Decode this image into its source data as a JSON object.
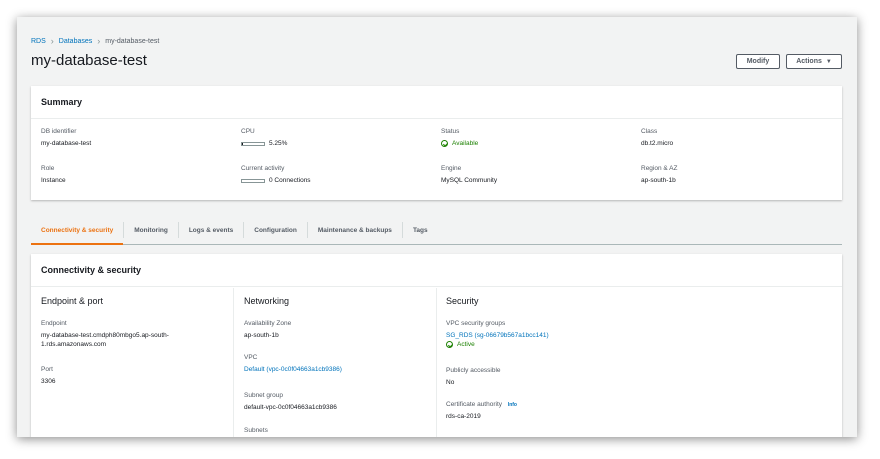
{
  "breadcrumb": {
    "items": [
      "RDS",
      "Databases",
      "my-database-test"
    ]
  },
  "page_title": "my-database-test",
  "buttons": {
    "modify": "Modify",
    "actions": "Actions"
  },
  "summary": {
    "title": "Summary",
    "db_identifier_label": "DB identifier",
    "db_identifier": "my-database-test",
    "role_label": "Role",
    "role": "Instance",
    "cpu_label": "CPU",
    "cpu": "5.25%",
    "cpu_fraction": 0.0525,
    "activity_label": "Current activity",
    "activity": "0 Connections",
    "activity_fraction": 0,
    "status_label": "Status",
    "status": "Available",
    "engine_label": "Engine",
    "engine": "MySQL Community",
    "class_label": "Class",
    "class": "db.t2.micro",
    "region_label": "Region & AZ",
    "region": "ap-south-1b"
  },
  "tabs": [
    "Connectivity & security",
    "Monitoring",
    "Logs & events",
    "Configuration",
    "Maintenance & backups",
    "Tags"
  ],
  "connectivity": {
    "title": "Connectivity & security",
    "endpoint_port": {
      "title": "Endpoint & port",
      "endpoint_label": "Endpoint",
      "endpoint_line1": "my-database-test.cmdph80mbgo5.ap-south-",
      "endpoint_line2": "1.rds.amazonaws.com",
      "port_label": "Port",
      "port": "3306"
    },
    "networking": {
      "title": "Networking",
      "az_label": "Availability Zone",
      "az": "ap-south-1b",
      "vpc_label": "VPC",
      "vpc": "Default (vpc-0c0f04663a1cb9386)",
      "subnet_group_label": "Subnet group",
      "subnet_group": "default-vpc-0c0f04663a1cb9386",
      "subnets_label": "Subnets"
    },
    "security": {
      "title": "Security",
      "sg_label": "VPC security groups",
      "sg": "SG_RDS (sg-06679b567a1bcc141)",
      "sg_status": "Active",
      "public_label": "Publicly accessible",
      "public": "No",
      "ca_label": "Certificate authority",
      "ca_info": "Info",
      "ca": "rds-ca-2019"
    }
  },
  "colors": {
    "link": "#0073bb",
    "accent": "#ec7211",
    "success": "#1d8102"
  }
}
